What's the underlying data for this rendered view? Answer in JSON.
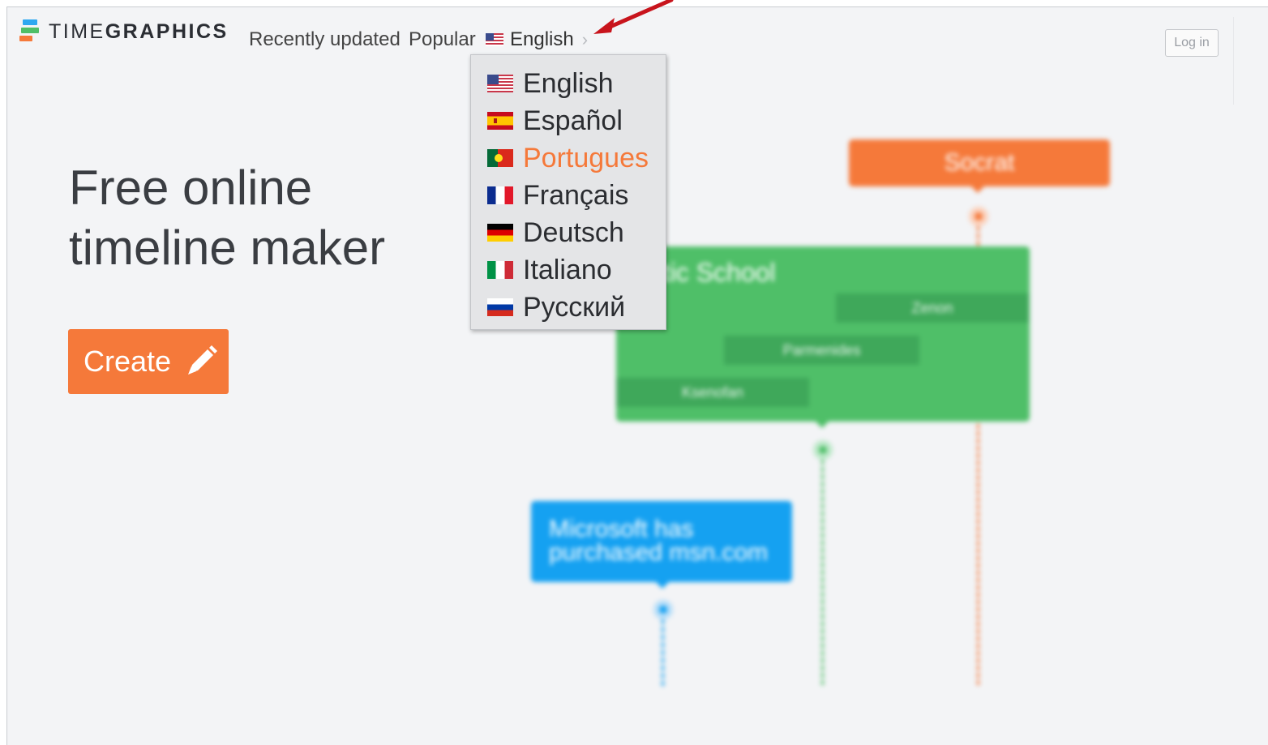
{
  "header": {
    "logo_light": "TIME",
    "logo_bold": "GRAPHICS",
    "nav": [
      "Recently updated",
      "Popular"
    ],
    "language_current": "English",
    "login_label": "Log in"
  },
  "hero": {
    "title": "Free online timeline maker",
    "create_label": "Create"
  },
  "language_menu": {
    "items": [
      {
        "label": "English",
        "flag": "us-flag-icon",
        "active": false
      },
      {
        "label": "Español",
        "flag": "es-flag-icon",
        "active": false
      },
      {
        "label": "Portugues",
        "flag": "pt-flag-icon",
        "active": true
      },
      {
        "label": "Français",
        "flag": "fr-flag-icon",
        "active": false
      },
      {
        "label": "Deutsch",
        "flag": "de-flag-icon",
        "active": false
      },
      {
        "label": "Italiano",
        "flag": "it-flag-icon",
        "active": false
      },
      {
        "label": "Русский",
        "flag": "ru-flag-icon",
        "active": false
      }
    ]
  },
  "timeline_preview": {
    "orange_event": "Socrat",
    "green_event": "atic School",
    "green_subs": [
      "Zenon",
      "Parmenides",
      "Ksenofan"
    ],
    "blue_event": "Microsoft has purchased msn.com"
  },
  "colors": {
    "accent_orange": "#f5793a",
    "green": "#4fbf68",
    "blue": "#15a1f1",
    "annotation_arrow": "#c8141c"
  }
}
